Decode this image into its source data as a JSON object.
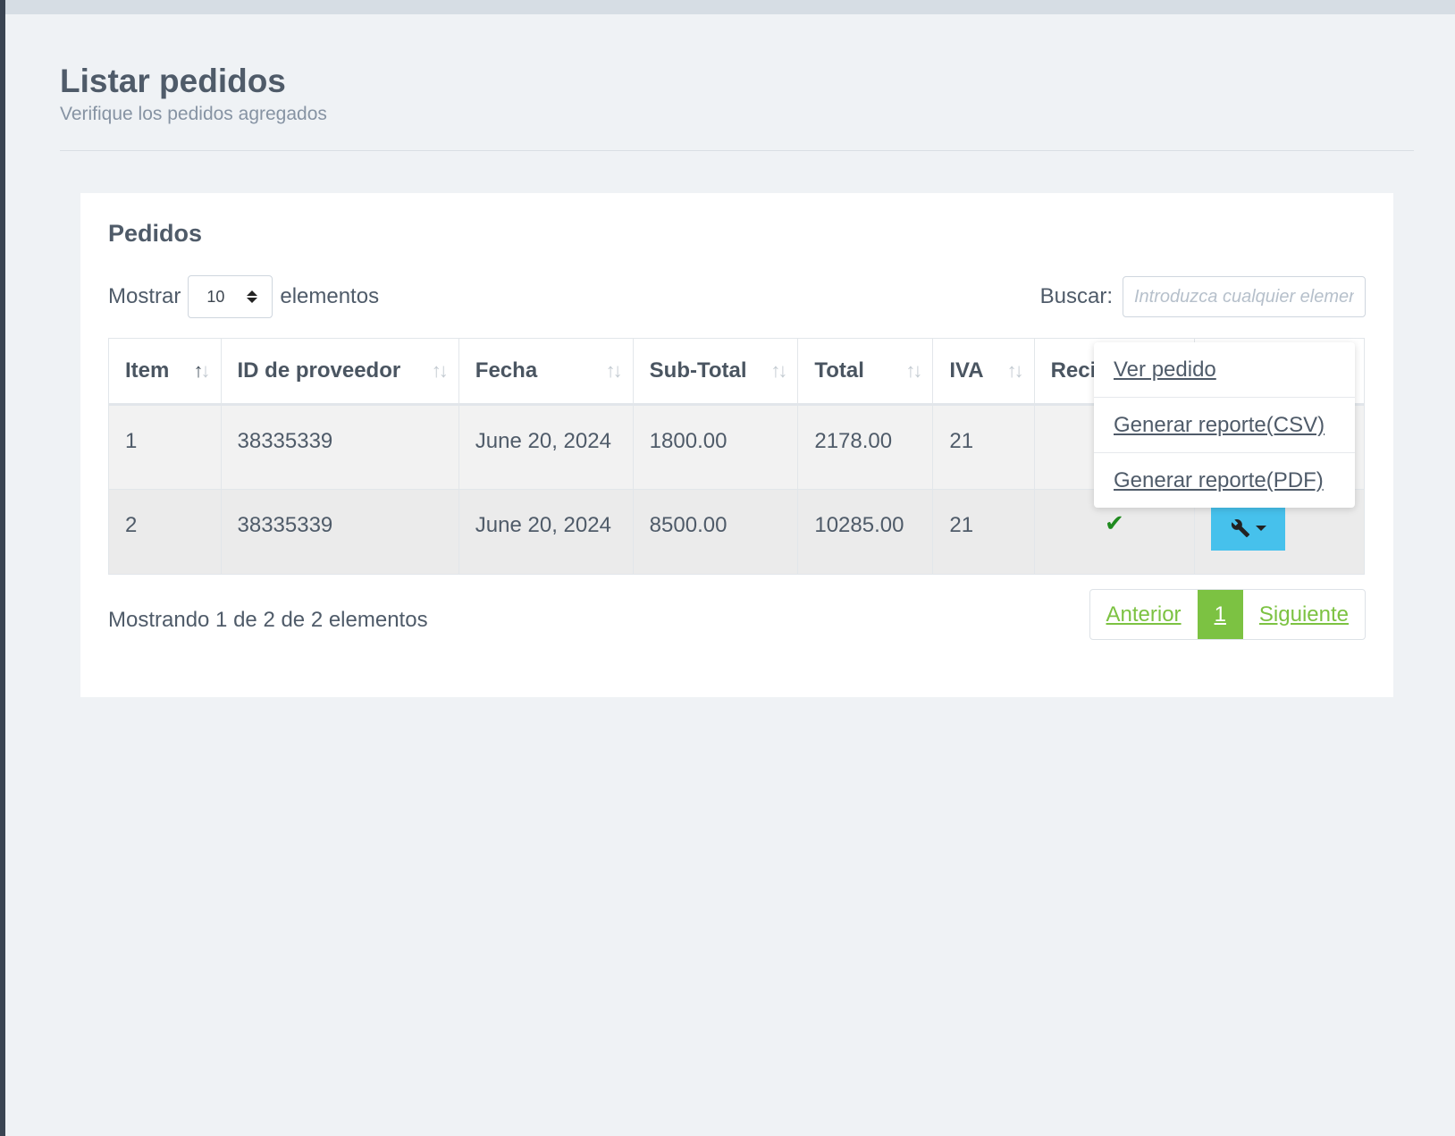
{
  "header": {
    "title": "Listar pedidos",
    "subtitle": "Verifique los pedidos agregados"
  },
  "card": {
    "title": "Pedidos"
  },
  "length": {
    "prefix": "Mostrar",
    "value": "10",
    "suffix": "elementos"
  },
  "search": {
    "label": "Buscar:",
    "placeholder": "Introduzca cualquier elemento"
  },
  "table": {
    "columns": [
      "Item",
      "ID de proveedor",
      "Fecha",
      "Sub-Total",
      "Total",
      "IVA",
      "Recibido",
      ""
    ],
    "rows": [
      {
        "item": "1",
        "proveedor": "38335339",
        "fecha": "June 20, 2024",
        "subtotal": "1800.00",
        "total": "2178.00",
        "iva": "21",
        "recibido": false
      },
      {
        "item": "2",
        "proveedor": "38335339",
        "fecha": "June 20, 2024",
        "subtotal": "8500.00",
        "total": "10285.00",
        "iva": "21",
        "recibido": true
      }
    ]
  },
  "info": "Mostrando 1 de 2 de 2 elementos",
  "pagination": {
    "prev": "Anterior",
    "current": "1",
    "next": "Siguiente"
  },
  "dropdown": {
    "items": [
      "Ver pedido",
      "Generar reporte(CSV)",
      "Generar reporte(PDF)"
    ]
  },
  "colors": {
    "accent_green": "#7cc242",
    "action_button": "#46c1ec",
    "check": "#1f8a1f"
  }
}
